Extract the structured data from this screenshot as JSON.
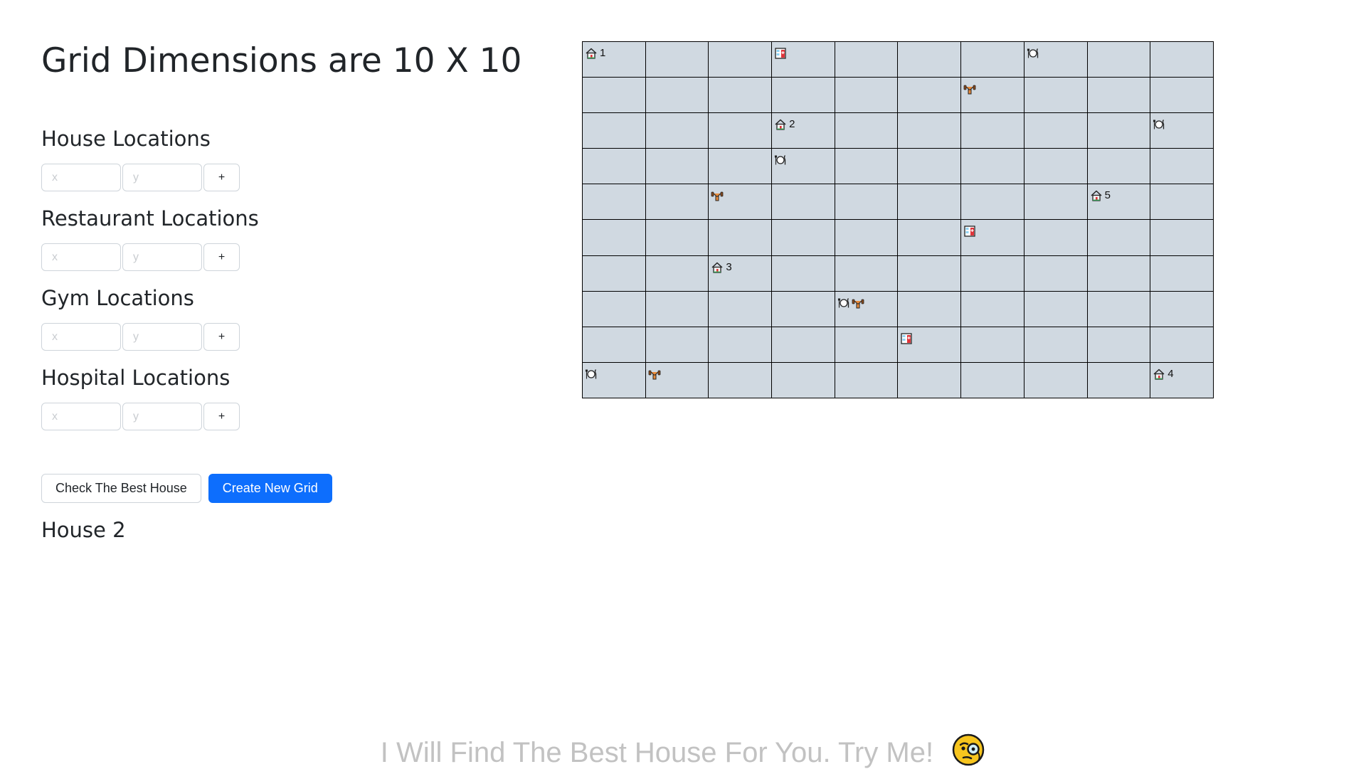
{
  "title": "Grid Dimensions are 10 X 10",
  "grid_size": {
    "cols": 10,
    "rows": 10
  },
  "sections": [
    {
      "key": "house",
      "heading": "House Locations",
      "x_placeholder": "x",
      "y_placeholder": "y",
      "add_label": "+"
    },
    {
      "key": "restaurant",
      "heading": "Restaurant Locations",
      "x_placeholder": "x",
      "y_placeholder": "y",
      "add_label": "+"
    },
    {
      "key": "gym",
      "heading": "Gym Locations",
      "x_placeholder": "x",
      "y_placeholder": "y",
      "add_label": "+"
    },
    {
      "key": "hospital",
      "heading": "Hospital Locations",
      "x_placeholder": "x",
      "y_placeholder": "y",
      "add_label": "+"
    }
  ],
  "actions": {
    "check_label": "Check The Best House",
    "create_label": "Create New Grid"
  },
  "result": "House 2",
  "footer": {
    "text": "I Will Find The Best House For You. Try Me!",
    "emoji": "face-with-monocle-icon"
  },
  "colors": {
    "cell_bg": "#d0d9e1",
    "primary": "#0d6efd",
    "footer_text": "#c2c2c2"
  },
  "places": [
    {
      "row": 0,
      "col": 0,
      "items": [
        {
          "type": "house",
          "label": "1"
        }
      ]
    },
    {
      "row": 0,
      "col": 3,
      "items": [
        {
          "type": "hospital"
        }
      ]
    },
    {
      "row": 0,
      "col": 7,
      "items": [
        {
          "type": "restaurant"
        }
      ]
    },
    {
      "row": 1,
      "col": 6,
      "items": [
        {
          "type": "gym"
        }
      ]
    },
    {
      "row": 2,
      "col": 3,
      "items": [
        {
          "type": "house",
          "label": "2"
        }
      ]
    },
    {
      "row": 2,
      "col": 9,
      "items": [
        {
          "type": "restaurant"
        }
      ]
    },
    {
      "row": 3,
      "col": 3,
      "items": [
        {
          "type": "restaurant"
        }
      ]
    },
    {
      "row": 4,
      "col": 2,
      "items": [
        {
          "type": "gym"
        }
      ]
    },
    {
      "row": 4,
      "col": 8,
      "items": [
        {
          "type": "house",
          "label": "5"
        }
      ]
    },
    {
      "row": 5,
      "col": 6,
      "items": [
        {
          "type": "hospital"
        }
      ]
    },
    {
      "row": 6,
      "col": 2,
      "items": [
        {
          "type": "house",
          "label": "3"
        }
      ]
    },
    {
      "row": 7,
      "col": 4,
      "items": [
        {
          "type": "restaurant"
        },
        {
          "type": "gym"
        }
      ]
    },
    {
      "row": 8,
      "col": 5,
      "items": [
        {
          "type": "hospital"
        }
      ]
    },
    {
      "row": 9,
      "col": 0,
      "items": [
        {
          "type": "restaurant"
        }
      ]
    },
    {
      "row": 9,
      "col": 1,
      "items": [
        {
          "type": "gym"
        }
      ]
    },
    {
      "row": 9,
      "col": 9,
      "items": [
        {
          "type": "house",
          "label": "4"
        }
      ]
    }
  ]
}
